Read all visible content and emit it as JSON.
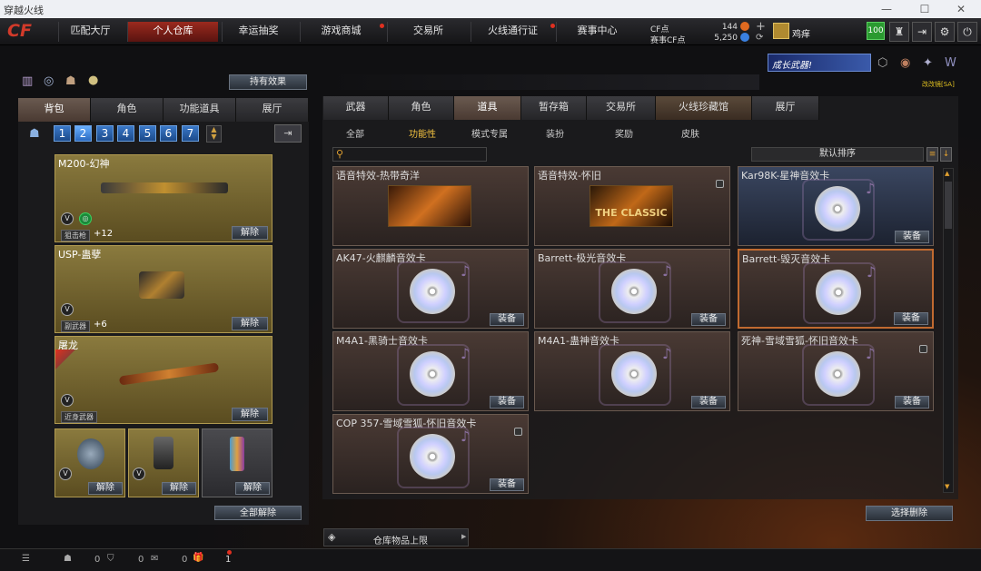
{
  "window": {
    "title": "穿越火线"
  },
  "nav": {
    "tabs": [
      "匹配大厅",
      "个人仓库",
      "幸运抽奖",
      "游戏商城",
      "交易所",
      "火线通行证",
      "赛事中心"
    ],
    "active": 1,
    "cf_label": "CF点",
    "cf_value": "144",
    "match_label": "赛事CF点",
    "match_value": "5,250",
    "plus": "+",
    "username": "鸡痒",
    "level": "100"
  },
  "toolbar": {
    "effect_button": "持有效果"
  },
  "left": {
    "tabs": [
      "背包",
      "角色",
      "功能道具",
      "展厅"
    ],
    "active": 0,
    "pages": [
      "1",
      "2",
      "3",
      "4",
      "5",
      "6",
      "7"
    ],
    "active_page": 1,
    "equipped": [
      {
        "name": "M200-幻神",
        "tag": "狙击枪",
        "plus": "+12",
        "button": "解除"
      },
      {
        "name": "USP-蛊孽",
        "tag": "副武器",
        "plus": "+6",
        "button": "解除"
      },
      {
        "name": "屠龙",
        "tag": "近身武器",
        "plus": "",
        "button": "解除"
      }
    ],
    "grenades": [
      {
        "button": "解除"
      },
      {
        "button": "解除"
      },
      {
        "button": "解除"
      }
    ],
    "unequip_all": "全部解除"
  },
  "right": {
    "banner": "成长武器!",
    "banner_sub": "改改镜[SA]",
    "tabs": [
      "武器",
      "角色",
      "道具",
      "暂存箱",
      "交易所",
      "火线珍藏馆",
      "展厅"
    ],
    "active": 2,
    "subtabs": [
      "全部",
      "功能性",
      "模式专属",
      "装扮",
      "奖励",
      "皮肤"
    ],
    "active_subtab": 1,
    "sort": "默认排序",
    "items": [
      {
        "title": "语音特效-热带奇洋",
        "kind": "banner",
        "button": "",
        "lock": false
      },
      {
        "title": "语音特效-怀旧",
        "kind": "classic",
        "classic_text": "THE CLASSIC",
        "button": "",
        "lock": true
      },
      {
        "title": "Kar98K-星神音效卡",
        "kind": "cd",
        "button": "装备",
        "lock": false,
        "style": "blue"
      },
      {
        "title": "AK47-火麒麟音效卡",
        "kind": "cd",
        "button": "装备",
        "lock": false
      },
      {
        "title": "Barrett-极光音效卡",
        "kind": "cd",
        "button": "装备",
        "lock": false
      },
      {
        "title": "Barrett-毁灭音效卡",
        "kind": "cd",
        "button": "装备",
        "lock": false,
        "style": "sel"
      },
      {
        "title": "M4A1-黑骑士音效卡",
        "kind": "cd",
        "button": "装备",
        "lock": false
      },
      {
        "title": "M4A1-蛊神音效卡",
        "kind": "cd",
        "button": "装备",
        "lock": false
      },
      {
        "title": "死神-雪域雪狐-怀旧音效卡",
        "kind": "cd",
        "button": "装备",
        "lock": true
      },
      {
        "title": "COP 357-雪域雪狐-怀旧音效卡",
        "kind": "cd",
        "button": "装备",
        "lock": true
      }
    ],
    "storage_limit": "仓库物品上限",
    "select_delete": "选择删除"
  },
  "bottombar": {
    "c1": "0",
    "c2": "0",
    "c3": "0",
    "c4": "1"
  }
}
